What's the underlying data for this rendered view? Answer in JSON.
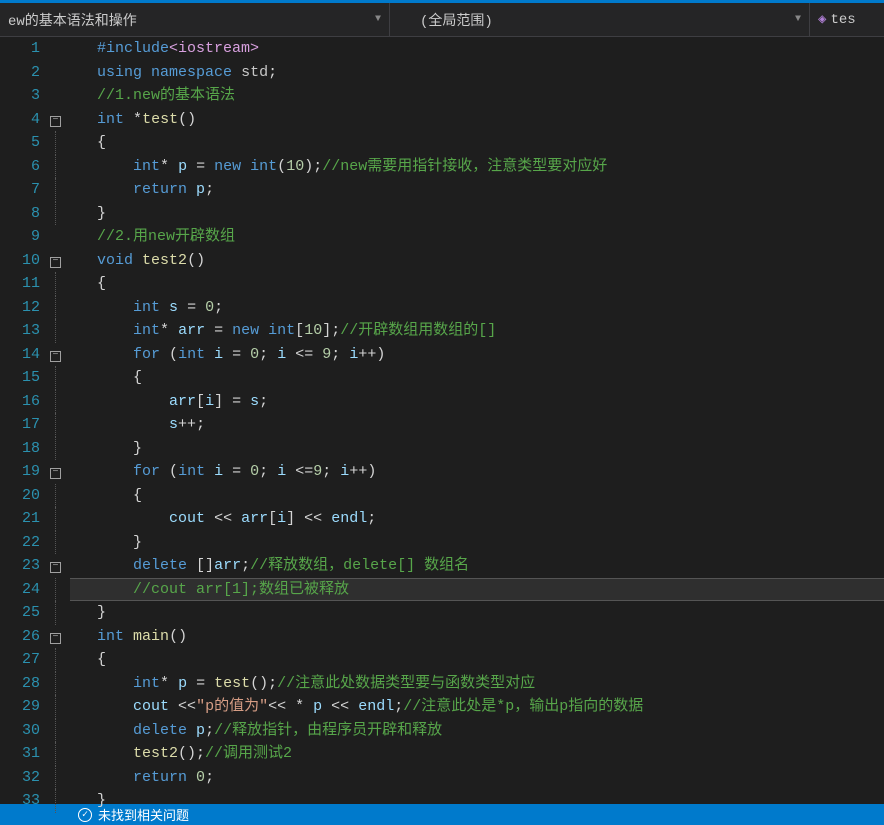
{
  "breadcrumb": {
    "item1": "ew的基本语法和操作",
    "item2": "(全局范围)",
    "item3": "tes"
  },
  "code": {
    "lines": [
      {
        "n": 1,
        "fold": "",
        "html": "<span class='kw'>#include</span><span class='ang'>&lt;iostream&gt;</span>"
      },
      {
        "n": 2,
        "fold": "",
        "html": "<span class='kw'>using</span> <span class='kw'>namespace</span> <span class='ns'>std</span><span class='punc'>;</span>"
      },
      {
        "n": 3,
        "fold": "",
        "html": "<span class='com'>//1.new的基本语法</span>"
      },
      {
        "n": 4,
        "fold": "box",
        "html": "<span class='type'>int</span> <span class='op'>*</span><span class='func'>test</span><span class='punc'>()</span>"
      },
      {
        "n": 5,
        "fold": "line",
        "html": "<span class='punc'>{</span>"
      },
      {
        "n": 6,
        "fold": "line",
        "html": "    <span class='type'>int</span><span class='op'>*</span> <span class='ident'>p</span> <span class='op'>=</span> <span class='kw'>new</span> <span class='type'>int</span><span class='punc'>(</span><span class='num'>10</span><span class='punc'>);</span><span class='com'>//new需要用指针接收，注意类型要对应好</span>"
      },
      {
        "n": 7,
        "fold": "line",
        "html": "    <span class='kw'>return</span> <span class='ident'>p</span><span class='punc'>;</span>"
      },
      {
        "n": 8,
        "fold": "line",
        "html": "<span class='punc'>}</span>"
      },
      {
        "n": 9,
        "fold": "",
        "html": "<span class='com'>//2.用new开辟数组</span>"
      },
      {
        "n": 10,
        "fold": "box",
        "html": "<span class='type'>void</span> <span class='func'>test2</span><span class='punc'>()</span>"
      },
      {
        "n": 11,
        "fold": "line",
        "html": "<span class='punc'>{</span>"
      },
      {
        "n": 12,
        "fold": "line",
        "html": "    <span class='type'>int</span> <span class='ident'>s</span> <span class='op'>=</span> <span class='num'>0</span><span class='punc'>;</span>"
      },
      {
        "n": 13,
        "fold": "line",
        "html": "    <span class='type'>int</span><span class='op'>*</span> <span class='ident'>arr</span> <span class='op'>=</span> <span class='kw'>new</span> <span class='type'>int</span><span class='punc'>[</span><span class='num'>10</span><span class='punc'>];</span><span class='com'>//开辟数组用数组的[]</span>"
      },
      {
        "n": 14,
        "fold": "box",
        "html": "    <span class='kw'>for</span> <span class='punc'>(</span><span class='type'>int</span> <span class='ident'>i</span> <span class='op'>=</span> <span class='num'>0</span><span class='punc'>;</span> <span class='ident'>i</span> <span class='op'>&lt;=</span> <span class='num'>9</span><span class='punc'>;</span> <span class='ident'>i</span><span class='op'>++</span><span class='punc'>)</span>"
      },
      {
        "n": 15,
        "fold": "line",
        "html": "    <span class='punc'>{</span>"
      },
      {
        "n": 16,
        "fold": "line",
        "html": "        <span class='ident'>arr</span><span class='punc'>[</span><span class='ident'>i</span><span class='punc'>]</span> <span class='op'>=</span> <span class='ident'>s</span><span class='punc'>;</span>"
      },
      {
        "n": 17,
        "fold": "line",
        "html": "        <span class='ident'>s</span><span class='op'>++</span><span class='punc'>;</span>"
      },
      {
        "n": 18,
        "fold": "line",
        "html": "    <span class='punc'>}</span>"
      },
      {
        "n": 19,
        "fold": "box",
        "html": "    <span class='kw'>for</span> <span class='punc'>(</span><span class='type'>int</span> <span class='ident'>i</span> <span class='op'>=</span> <span class='num'>0</span><span class='punc'>;</span> <span class='ident'>i</span> <span class='op'>&lt;=</span><span class='num'>9</span><span class='punc'>;</span> <span class='ident'>i</span><span class='op'>++</span><span class='punc'>)</span>"
      },
      {
        "n": 20,
        "fold": "line",
        "html": "    <span class='punc'>{</span>"
      },
      {
        "n": 21,
        "fold": "line",
        "html": "        <span class='ident'>cout</span> <span class='op'>&lt;&lt;</span> <span class='ident'>arr</span><span class='punc'>[</span><span class='ident'>i</span><span class='punc'>]</span> <span class='op'>&lt;&lt;</span> <span class='ident'>endl</span><span class='punc'>;</span>"
      },
      {
        "n": 22,
        "fold": "line",
        "html": "    <span class='punc'>}</span>"
      },
      {
        "n": 23,
        "fold": "box",
        "html": "    <span class='kw'>delete</span> <span class='punc'>[]</span><span class='ident'>arr</span><span class='punc'>;</span><span class='com'>//释放数组，delete[] 数组名</span>"
      },
      {
        "n": 24,
        "fold": "line",
        "html": "    <span class='com'>//cout arr[1];数组已被释放</span>",
        "hl": true
      },
      {
        "n": 25,
        "fold": "line",
        "html": "<span class='punc'>}</span>"
      },
      {
        "n": 26,
        "fold": "box",
        "html": "<span class='type'>int</span> <span class='func'>main</span><span class='punc'>()</span>"
      },
      {
        "n": 27,
        "fold": "line",
        "html": "<span class='punc'>{</span>"
      },
      {
        "n": 28,
        "fold": "line",
        "html": "    <span class='type'>int</span><span class='op'>*</span> <span class='ident'>p</span> <span class='op'>=</span> <span class='func'>test</span><span class='punc'>();</span><span class='com'>//注意此处数据类型要与函数类型对应</span>"
      },
      {
        "n": 29,
        "fold": "line",
        "html": "    <span class='ident'>cout</span> <span class='op'>&lt;&lt;</span><span class='str'>\"p的值为\"</span><span class='op'>&lt;&lt;</span> <span class='op'>*</span> <span class='ident'>p</span> <span class='op'>&lt;&lt;</span> <span class='ident'>endl</span><span class='punc'>;</span><span class='com'>//注意此处是*p，输出p指向的数据</span>"
      },
      {
        "n": 30,
        "fold": "line",
        "html": "    <span class='kw'>delete</span> <span class='ident'>p</span><span class='punc'>;</span><span class='com'>//释放指针，由程序员开辟和释放</span>"
      },
      {
        "n": 31,
        "fold": "line",
        "html": "    <span class='func'>test2</span><span class='punc'>();</span><span class='com'>//调用测试2</span>"
      },
      {
        "n": 32,
        "fold": "line",
        "html": "    <span class='kw'>return</span> <span class='num'>0</span><span class='punc'>;</span>"
      },
      {
        "n": 33,
        "fold": "line",
        "html": "<span class='punc'>}</span>"
      }
    ]
  },
  "footer": {
    "text": "未找到相关问题"
  }
}
